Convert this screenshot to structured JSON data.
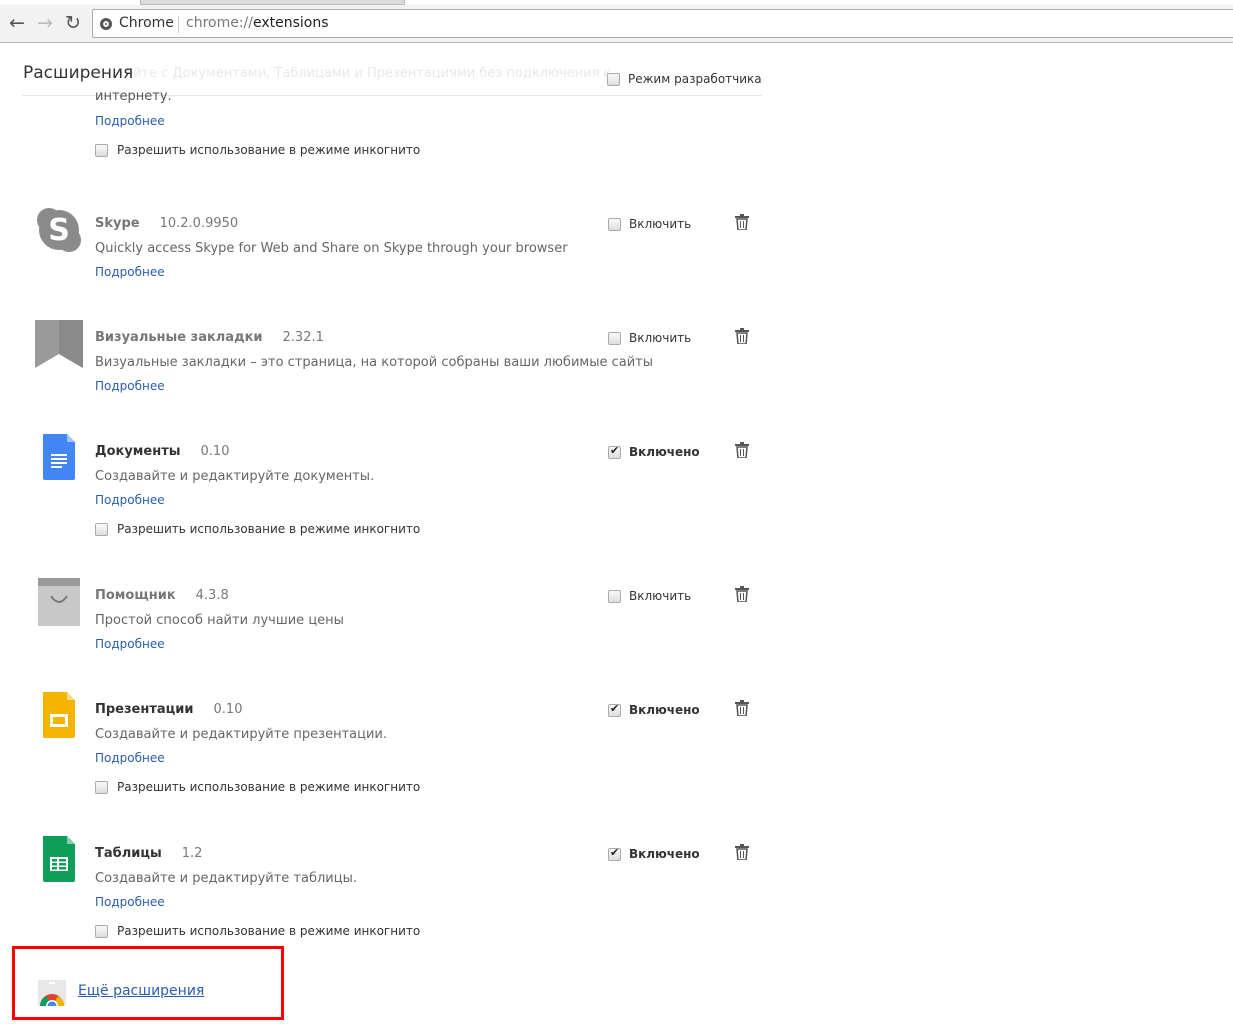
{
  "browser": {
    "chip": "Chrome",
    "url_scheme": "chrome://",
    "url_path": "extensions"
  },
  "page": {
    "title": "Расширения",
    "developer_mode_label": "Режим разработчика",
    "developer_mode": false,
    "faded_header_text": "айте с Документами, Таблицами и Презентациями без подключения к"
  },
  "top_partial": {
    "description_tail": "интернету.",
    "details": "Подробнее",
    "incognito": "Разрешить использование в режиме инкогнито"
  },
  "extensions": [
    {
      "name": "Skype",
      "version": "10.2.0.9950",
      "description": "Quickly access Skype for Web and Share on Skype through your browser",
      "details": "Подробнее",
      "enabled": false,
      "enable_label": "Включить",
      "icon": "skype-icon"
    },
    {
      "name": "Визуальные закладки",
      "version": "2.32.1",
      "description": "Визуальные закладки – это страница, на которой собраны ваши любимые сайты",
      "details": "Подробнее",
      "enabled": false,
      "enable_label": "Включить",
      "icon": "bookmark-icon"
    },
    {
      "name": "Документы",
      "version": "0.10",
      "description": "Создавайте и редактируйте документы.",
      "details": "Подробнее",
      "enabled": true,
      "enable_label": "Включено",
      "incognito": "Разрешить использование в режиме инкогнито",
      "icon": "docs-icon"
    },
    {
      "name": "Помощник",
      "version": "4.3.8",
      "description": "Простой способ найти лучшие цены",
      "details": "Подробнее",
      "enabled": false,
      "enable_label": "Включить",
      "icon": "shopping-bag-icon"
    },
    {
      "name": "Презентации",
      "version": "0.10",
      "description": "Создавайте и редактируйте презентации.",
      "details": "Подробнее",
      "enabled": true,
      "enable_label": "Включено",
      "incognito": "Разрешить использование в режиме инкогнито",
      "icon": "slides-icon"
    },
    {
      "name": "Таблицы",
      "version": "1.2",
      "description": "Создавайте и редактируйте таблицы.",
      "details": "Подробнее",
      "enabled": true,
      "enable_label": "Включено",
      "incognito": "Разрешить использование в режиме инкогнито",
      "icon": "sheets-icon"
    }
  ],
  "more_extensions": "Ещё расширения",
  "colors": {
    "link": "#2a5db0",
    "highlight_box": "#ff0000",
    "docs": "#4285f4",
    "slides": "#f4b400",
    "sheets": "#0f9d58"
  }
}
